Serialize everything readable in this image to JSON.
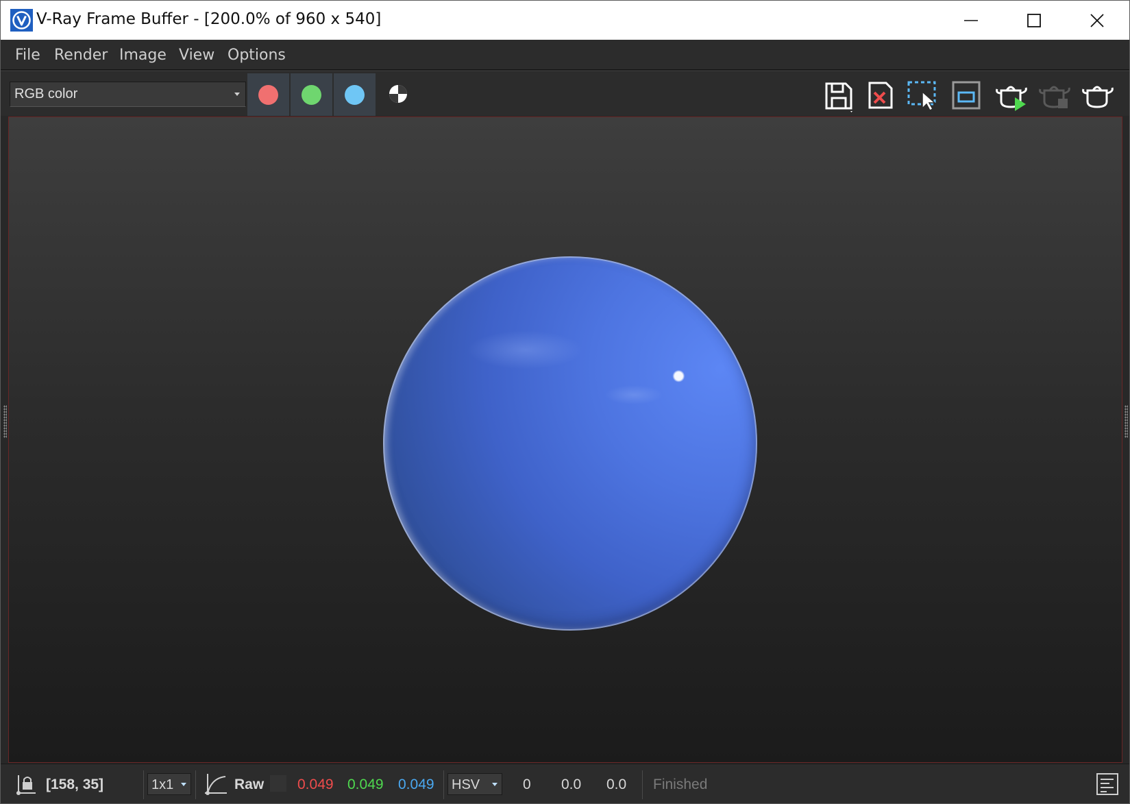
{
  "window": {
    "title": "V-Ray Frame Buffer - [200.0% of 960 x 540]",
    "logo_letter": "V",
    "controls": [
      "minimize-icon",
      "maximize-icon",
      "close-icon"
    ]
  },
  "menu": {
    "items": [
      "File",
      "Render",
      "Image",
      "View",
      "Options"
    ]
  },
  "toolbar": {
    "channel": "RGB color",
    "swatches": [
      {
        "name": "red-channel",
        "color": "#f07070"
      },
      {
        "name": "green-channel",
        "color": "#6fd66f"
      },
      {
        "name": "blue-channel",
        "color": "#6fc6f5"
      }
    ],
    "tools": [
      "save-image-icon",
      "clear-image-icon",
      "region-render-icon",
      "track-mouse-icon",
      "render-icon",
      "stop-render-icon",
      "render-last-icon"
    ]
  },
  "status": {
    "coords": "[158, 35]",
    "sample_size": "1x1",
    "mode_label": "Raw",
    "r": "0.049",
    "g": "0.049",
    "b": "0.049",
    "r_color": "#ef4c4c",
    "g_color": "#4fd94f",
    "b_color": "#4aa8f0",
    "color_model": "HSV",
    "h": "0",
    "s": "0.0",
    "v": "0.0",
    "state": "Finished"
  }
}
